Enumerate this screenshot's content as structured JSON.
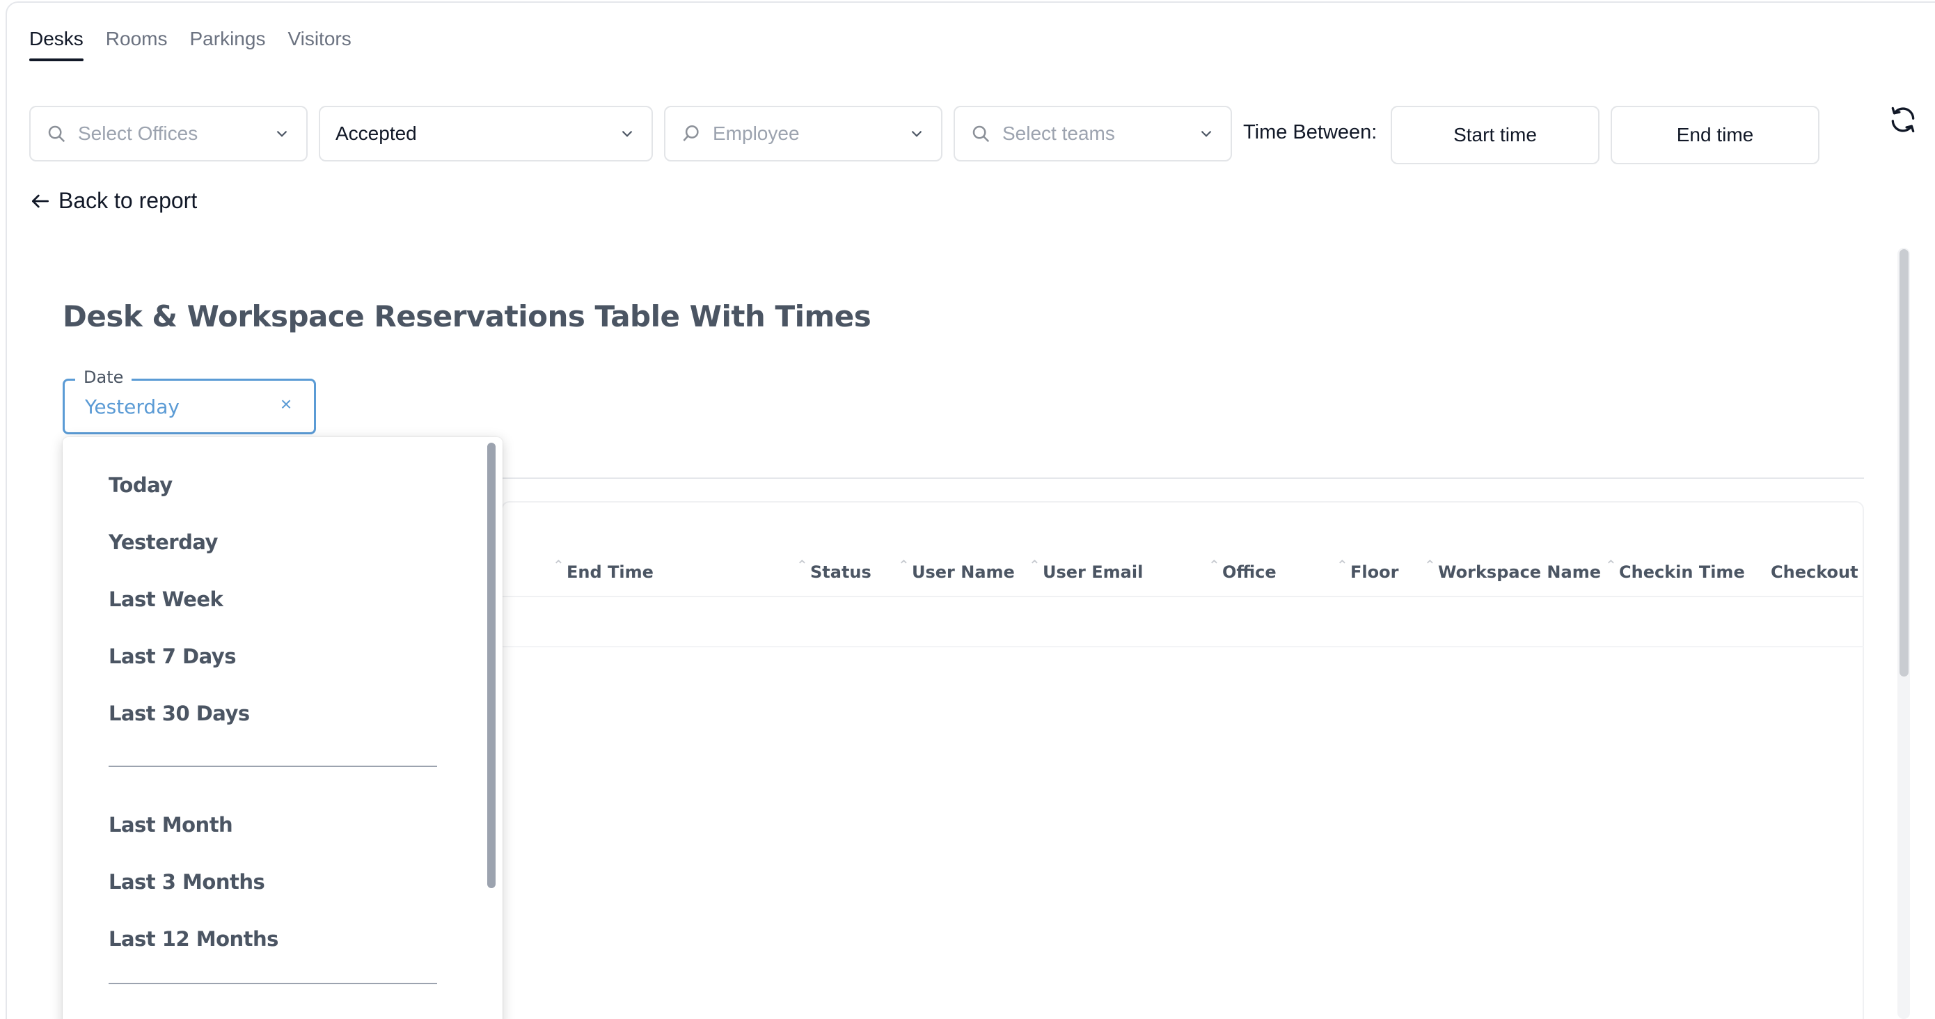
{
  "tabs": [
    {
      "label": "Desks",
      "active": true
    },
    {
      "label": "Rooms",
      "active": false
    },
    {
      "label": "Parkings",
      "active": false
    },
    {
      "label": "Visitors",
      "active": false
    }
  ],
  "filters": {
    "offices_placeholder": "Select Offices",
    "status_value": "Accepted",
    "employee_placeholder": "Employee",
    "teams_placeholder": "Select teams",
    "time_between_label": "Time Between:",
    "start_time_label": "Start time",
    "end_time_label": "End time"
  },
  "back_link": "Back to report",
  "report": {
    "title": "Desk & Workspace Reservations Table With Times",
    "date_label": "Date",
    "date_value": "Yesterday",
    "clear_icon": "×"
  },
  "table": {
    "columns": [
      "End Time",
      "Status",
      "User Name",
      "User Email",
      "Office",
      "Floor",
      "Workspace Name",
      "Checkin Time",
      "Checkout Time"
    ]
  },
  "date_options": {
    "group1": [
      "Today",
      "Yesterday",
      "Last Week",
      "Last 7 Days",
      "Last 30 Days"
    ],
    "group2": [
      "Last Month",
      "Last 3 Months",
      "Last 12 Months"
    ]
  },
  "colors": {
    "accent": "#5b9bd5",
    "text_primary": "#111827",
    "text_muted": "#6b7280"
  },
  "icons": {
    "search": "search-icon",
    "chevron": "chevron-down-icon",
    "refresh": "refresh-icon",
    "back": "arrow-left-icon"
  }
}
